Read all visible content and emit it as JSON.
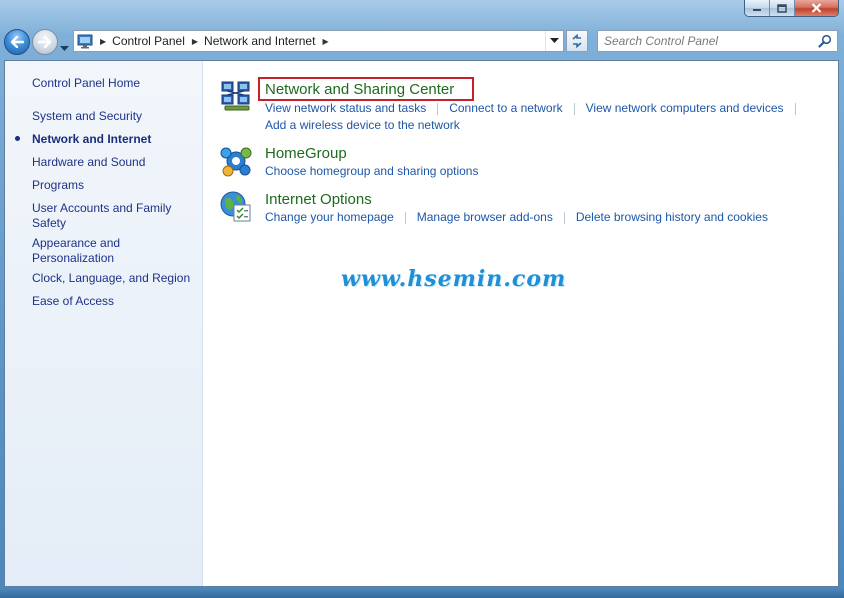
{
  "window": {
    "caption_buttons": [
      "minimize-icon",
      "maximize-icon",
      "close-icon"
    ]
  },
  "navigation": {
    "breadcrumbs": [
      "Control Panel",
      "Network and Internet"
    ],
    "search_placeholder": "Search Control Panel"
  },
  "sidebar": {
    "items": [
      {
        "label": "Control Panel Home",
        "current": false
      },
      {
        "label": "System and Security",
        "current": false
      },
      {
        "label": "Network and Internet",
        "current": true
      },
      {
        "label": "Hardware and Sound",
        "current": false
      },
      {
        "label": "Programs",
        "current": false
      },
      {
        "label": "User Accounts and Family Safety",
        "current": false
      },
      {
        "label": "Appearance and Personalization",
        "current": false
      },
      {
        "label": "Clock, Language, and Region",
        "current": false
      },
      {
        "label": "Ease of Access",
        "current": false
      }
    ]
  },
  "categories": [
    {
      "title": "Network and Sharing Center",
      "icon": "network-icon",
      "tasks": [
        "View network status and tasks",
        "Connect to a network",
        "View network computers and devices",
        "Add a wireless device to the network"
      ]
    },
    {
      "title": "HomeGroup",
      "icon": "homegroup-icon",
      "tasks": [
        "Choose homegroup and sharing options"
      ]
    },
    {
      "title": "Internet Options",
      "icon": "internet-options-icon",
      "tasks": [
        "Change your homepage",
        "Manage browser add-ons",
        "Delete browsing history and cookies"
      ]
    }
  ],
  "watermark": "www.hsemin.com",
  "colors": {
    "link": "#1d57a8",
    "category_title": "#1d6b1d",
    "highlight_box": "#c8202a",
    "watermark": "#1f8fd8"
  }
}
